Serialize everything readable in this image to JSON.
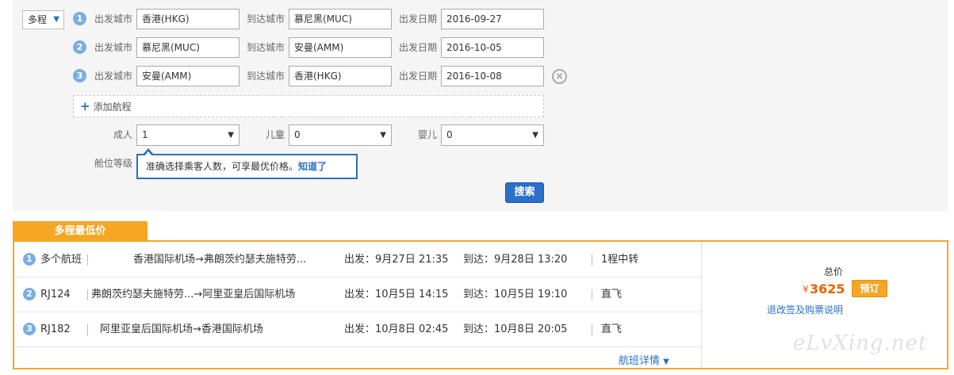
{
  "search": {
    "trip_type": "多程",
    "segments": [
      {
        "num": "1",
        "dep_label": "出发城市",
        "dep_value": "香港(HKG)",
        "arr_label": "到达城市",
        "arr_value": "慕尼黑(MUC)",
        "date_label": "出发日期",
        "date_value": "2016-09-27"
      },
      {
        "num": "2",
        "dep_label": "出发城市",
        "dep_value": "慕尼黑(MUC)",
        "arr_label": "到达城市",
        "arr_value": "安曼(AMM)",
        "date_label": "出发日期",
        "date_value": "2016-10-05"
      },
      {
        "num": "3",
        "dep_label": "出发城市",
        "dep_value": "安曼(AMM)",
        "arr_label": "到达城市",
        "arr_value": "香港(HKG)",
        "date_label": "出发日期",
        "date_value": "2016-10-08"
      }
    ],
    "add_segment_label": "添加航程",
    "adults_label": "成人",
    "adults_value": "1",
    "children_label": "儿童",
    "children_value": "0",
    "infants_label": "婴儿",
    "infants_value": "0",
    "cabin_label": "舱位等级",
    "tip_text": "准确选择乘客人数，可享最优价格。",
    "tip_ok": "知道了",
    "search_button": "搜索"
  },
  "results": {
    "tab_label": "多程最低价",
    "rows": [
      {
        "num": "1",
        "flight": "多个航班",
        "route": "香港国际机场→弗朗茨约瑟夫施特劳...",
        "dep": "出发：9月27日 21:35",
        "arr": "到达：9月28日 13:20",
        "stops": "1程中转"
      },
      {
        "num": "2",
        "flight": "RJ124",
        "route": "弗朗茨约瑟夫施特劳...→阿里亚皇后国际机场",
        "dep": "出发：10月5日 14:15",
        "arr": "到达：10月5日 19:10",
        "stops": "直飞"
      },
      {
        "num": "3",
        "flight": "RJ182",
        "route": "阿里亚皇后国际机场→香港国际机场",
        "dep": "出发：10月8日 02:45",
        "arr": "到达：10月8日 20:05",
        "stops": "直飞"
      }
    ],
    "details_link": "航班详情",
    "total_label": "总价",
    "currency": "¥",
    "price": "3625",
    "book_button": "预订",
    "policy_link": "退改签及购票说明"
  },
  "watermark": "eLvXing.net"
}
